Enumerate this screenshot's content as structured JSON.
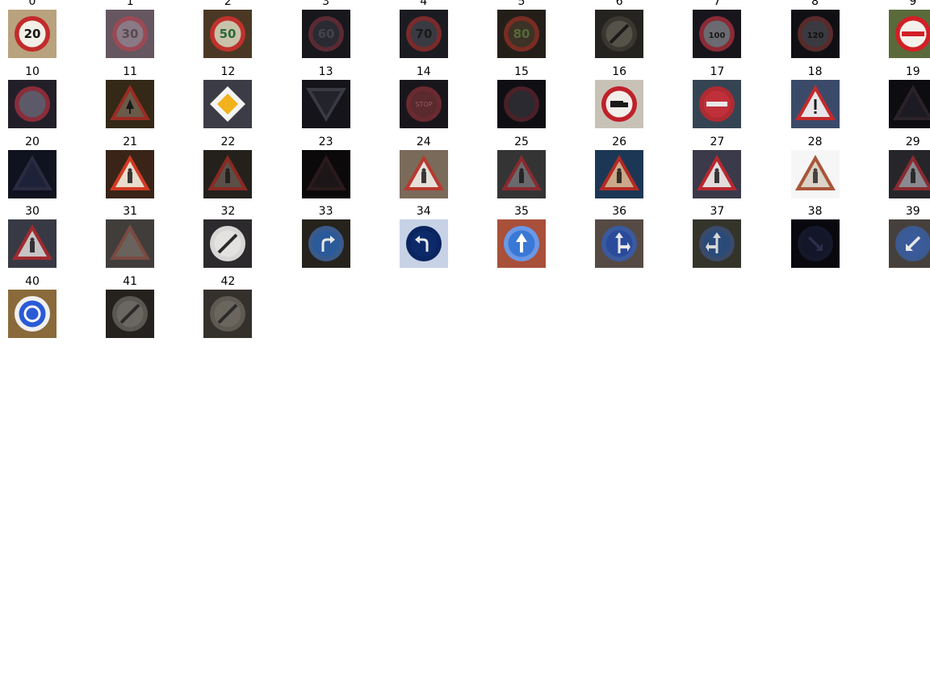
{
  "figure": {
    "columns": 10,
    "background_color": "#ffffff"
  },
  "thumbnails": [
    {
      "label": "0",
      "shape": "circle",
      "icon": "speed-limit-20-sign",
      "bg": "#b9a27e",
      "plate": "#f2efe6",
      "rim": "#c22b2b",
      "symbol": "20",
      "symbol_color": "#141414",
      "bright": 1.0
    },
    {
      "label": "1",
      "shape": "circle",
      "icon": "speed-limit-30-sign",
      "bg": "#6c5b65",
      "plate": "#8a7a86",
      "rim": "#9a4a55",
      "symbol": "30",
      "symbol_color": "#5a4a50",
      "bright": 0.9
    },
    {
      "label": "2",
      "shape": "circle",
      "icon": "speed-limit-50-sign",
      "bg": "#4e3c27",
      "plate": "#c9c2aa",
      "rim": "#c0312c",
      "symbol": "50",
      "symbol_color": "#2a6a3a",
      "bright": 0.9
    },
    {
      "label": "3",
      "shape": "circle",
      "icon": "speed-limit-60-sign",
      "bg": "#1d1d24",
      "plate": "#2a2a33",
      "rim": "#5a2a33",
      "symbol": "60",
      "symbol_color": "#444450",
      "bright": 0.6
    },
    {
      "label": "4",
      "shape": "circle",
      "icon": "speed-limit-70-sign",
      "bg": "#1f2026",
      "plate": "#3a3a42",
      "rim": "#7a2a2a",
      "symbol": "70",
      "symbol_color": "#1a1a1a",
      "bright": 0.75
    },
    {
      "label": "5",
      "shape": "circle",
      "icon": "speed-limit-80-sign",
      "bg": "#2e2620",
      "plate": "#3c3226",
      "rim": "#7a2c22",
      "symbol": "80",
      "symbol_color": "#556b3a",
      "bright": 0.6
    },
    {
      "label": "6",
      "shape": "circle",
      "icon": "end-speed-limit-80-sign",
      "bg": "#2c2a25",
      "plate": "#55524a",
      "rim": "#3a3630",
      "symbol": "/",
      "symbol_color": "#1a1a1a",
      "bright": 0.7
    },
    {
      "label": "7",
      "shape": "circle",
      "icon": "speed-limit-100-sign",
      "bg": "#1c1820",
      "plate": "#6a6a70",
      "rim": "#8a2a35",
      "symbol": "100",
      "symbol_color": "#1a1a1a",
      "bright": 0.75
    },
    {
      "label": "8",
      "shape": "circle",
      "icon": "speed-limit-120-sign",
      "bg": "#15151a",
      "plate": "#3a3a40",
      "rim": "#5a2a2a",
      "symbol": "120",
      "symbol_color": "#111111",
      "bright": 0.6
    },
    {
      "label": "9",
      "shape": "circle",
      "icon": "no-overtaking-sign",
      "bg": "#5a6a3a",
      "plate": "#f4f1ec",
      "rim": "#d21f26",
      "symbol": "==",
      "symbol_color": "#d21f26",
      "bright": 1.0
    },
    {
      "label": "10",
      "shape": "circle",
      "icon": "no-overtaking-trucks-sign",
      "bg": "#2a2530",
      "plate": "#5c5a68",
      "rim": "#8a2c3a",
      "symbol": "",
      "symbol_color": "#2a2a2a",
      "bright": 0.7
    },
    {
      "label": "11",
      "shape": "triangle",
      "icon": "right-of-way-sign",
      "bg": "#3c2e1a",
      "plate": "#6a5a48",
      "rim": "#9a2c22",
      "symbol": "^",
      "symbol_color": "#1a1a1a",
      "bright": 0.75
    },
    {
      "label": "12",
      "shape": "diamond",
      "icon": "priority-road-sign",
      "bg": "#3c3c46",
      "plate": "#f2f2f0",
      "rim": "#f4f4f4",
      "symbol": "",
      "symbol_color": "#f2b21c",
      "bright": 1.0
    },
    {
      "label": "13",
      "shape": "inverted",
      "icon": "yield-sign",
      "bg": "#1a1b22",
      "plate": "#23242b",
      "rim": "#3a3a42",
      "symbol": "",
      "symbol_color": "#1a1a1a",
      "bright": 0.55
    },
    {
      "label": "14",
      "shape": "circle",
      "icon": "stop-sign",
      "bg": "#1e1a20",
      "plate": "#5a2a2e",
      "rim": "#6a2a30",
      "symbol": "STOP",
      "symbol_color": "#9a5a60",
      "bright": 0.7
    },
    {
      "label": "15",
      "shape": "circle",
      "icon": "no-vehicles-sign",
      "bg": "#14141a",
      "plate": "#2a2a30",
      "rim": "#4a2028",
      "symbol": "",
      "symbol_color": "#1a1a1a",
      "bright": 0.5
    },
    {
      "label": "16",
      "shape": "circle",
      "icon": "no-trucks-sign",
      "bg": "#c8c2b6",
      "plate": "#f2eeea",
      "rim": "#c0202a",
      "symbol": "truck",
      "symbol_color": "#1a1a1a",
      "bright": 1.0
    },
    {
      "label": "17",
      "shape": "circle",
      "icon": "no-entry-sign",
      "bg": "#3a4a5a",
      "plate": "#c0303a",
      "rim": "#b02a32",
      "symbol": "-",
      "symbol_color": "#e8e8e8",
      "bright": 0.85
    },
    {
      "label": "18",
      "shape": "triangle",
      "icon": "general-caution-sign",
      "bg": "#3c4a6a",
      "plate": "#e8e6ea",
      "rim": "#c42a2a",
      "symbol": "!",
      "symbol_color": "#1a1a1a",
      "bright": 1.0
    },
    {
      "label": "19",
      "shape": "triangle",
      "icon": "dangerous-curve-left-sign",
      "bg": "#141218",
      "plate": "#1c1a22",
      "rim": "#2a2228",
      "symbol": "",
      "symbol_color": "#1a1a1a",
      "bright": 0.4
    },
    {
      "label": "20",
      "shape": "triangle",
      "icon": "dangerous-curve-right-sign",
      "bg": "#15182a",
      "plate": "#1e2238",
      "rim": "#2a2a40",
      "symbol": "",
      "symbol_color": "#3a3a5a",
      "bright": 0.5
    },
    {
      "label": "21",
      "shape": "triangle",
      "icon": "double-curve-sign",
      "bg": "#3a2418",
      "plate": "#e8dccc",
      "rim": "#d23a22",
      "symbol": "s",
      "symbol_color": "#1a1a1a",
      "bright": 1.0
    },
    {
      "label": "22",
      "shape": "triangle",
      "icon": "bumpy-road-sign",
      "bg": "#2a2620",
      "plate": "#5a5048",
      "rim": "#8a2a22",
      "symbol": "~",
      "symbol_color": "#1a1a1a",
      "bright": 0.75
    },
    {
      "label": "23",
      "shape": "triangle",
      "icon": "slippery-road-sign",
      "bg": "#120e10",
      "plate": "#1c1618",
      "rim": "#2a1a1c",
      "symbol": "",
      "symbol_color": "#1a1a1a",
      "bright": 0.4
    },
    {
      "label": "24",
      "shape": "triangle",
      "icon": "road-narrows-sign",
      "bg": "#7a6a5a",
      "plate": "#e6e0da",
      "rim": "#b83a2e",
      "symbol": "|",
      "symbol_color": "#1a1a1a",
      "bright": 1.0
    },
    {
      "label": "25",
      "shape": "triangle",
      "icon": "road-work-sign",
      "bg": "#3a3a3c",
      "plate": "#6a6a6e",
      "rim": "#8a2a2e",
      "symbol": "w",
      "symbol_color": "#1a1a1a",
      "bright": 0.8
    },
    {
      "label": "26",
      "shape": "triangle",
      "icon": "traffic-signals-sign",
      "bg": "#1e3a5a",
      "plate": "#caa88a",
      "rim": "#b42a22",
      "symbol": "i",
      "symbol_color": "#1a1a1a",
      "bright": 0.9
    },
    {
      "label": "27",
      "shape": "triangle",
      "icon": "pedestrians-sign",
      "bg": "#3a3a4a",
      "plate": "#e2dcdc",
      "rim": "#b8282e",
      "symbol": "p",
      "symbol_color": "#1a1a1a",
      "bright": 1.0
    },
    {
      "label": "28",
      "shape": "triangle",
      "icon": "children-crossing-sign",
      "bg": "#f6f6f6",
      "plate": "#dcd4c8",
      "rim": "#a8563a",
      "symbol": "c",
      "symbol_color": "#2a2a2a",
      "bright": 1.0
    },
    {
      "label": "29",
      "shape": "triangle",
      "icon": "bicycles-crossing-sign",
      "bg": "#2a2a2e",
      "plate": "#8a8a90",
      "rim": "#8a2a30",
      "symbol": "b",
      "symbol_color": "#1a1a1a",
      "bright": 0.85
    },
    {
      "label": "30",
      "shape": "triangle",
      "icon": "beware-of-ice-sign",
      "bg": "#3a3e48",
      "plate": "#c8c4c6",
      "rim": "#a02a2e",
      "symbol": "*",
      "symbol_color": "#1a1a1a",
      "bright": 0.9
    },
    {
      "label": "31",
      "shape": "triangle",
      "icon": "wild-animals-crossing-sign",
      "bg": "#4a4644",
      "plate": "#6a625c",
      "rim": "#7a4a40",
      "symbol": "",
      "symbol_color": "#3a3430",
      "bright": 0.75
    },
    {
      "label": "32",
      "shape": "circle",
      "icon": "end-all-limits-sign",
      "bg": "#2c2a2c",
      "plate": "#e4e2e0",
      "rim": "#d8d6d4",
      "symbol": "/",
      "symbol_color": "#2a2a2a",
      "bright": 1.0
    },
    {
      "label": "33",
      "shape": "circle",
      "icon": "turn-right-ahead-sign",
      "bg": "#2a2620",
      "plate": "#2a5a9a",
      "rim": "#3a5a8a",
      "symbol": "r",
      "symbol_color": "#e8e8e8",
      "bright": 0.85
    },
    {
      "label": "34",
      "shape": "circle",
      "icon": "turn-left-ahead-sign",
      "bg": "#c8d2e6",
      "plate": "#0c2a6a",
      "rim": "#0a2460",
      "symbol": "l",
      "symbol_color": "#e8e8e8",
      "bright": 1.0
    },
    {
      "label": "35",
      "shape": "circle",
      "icon": "ahead-only-sign",
      "bg": "#a8503a",
      "plate": "#3a78d6",
      "rim": "#6a98e6",
      "symbol": "up",
      "symbol_color": "#ffffff",
      "bright": 1.0
    },
    {
      "label": "36",
      "shape": "circle",
      "icon": "go-straight-or-right-sign",
      "bg": "#5a5048",
      "plate": "#2a4a9a",
      "rim": "#3a5aa0",
      "symbol": "sr",
      "symbol_color": "#e8e8e8",
      "bright": 0.9
    },
    {
      "label": "37",
      "shape": "circle",
      "icon": "go-straight-or-left-sign",
      "bg": "#3a3a30",
      "plate": "#2a4a7a",
      "rim": "#3a4a6a",
      "symbol": "sl",
      "symbol_color": "#d8d8d8",
      "bright": 0.8
    },
    {
      "label": "38",
      "shape": "circle",
      "icon": "keep-right-sign",
      "bg": "#0c0c14",
      "plate": "#121628",
      "rim": "#14182a",
      "symbol": "kr",
      "symbol_color": "#2a2e4a",
      "bright": 0.45
    },
    {
      "label": "39",
      "shape": "circle",
      "icon": "keep-left-sign",
      "bg": "#4a4440",
      "plate": "#3a5a9a",
      "rim": "#3a5a90",
      "symbol": "kl",
      "symbol_color": "#e8e8e8",
      "bright": 0.9
    },
    {
      "label": "40",
      "shape": "circle",
      "icon": "roundabout-mandatory-sign",
      "bg": "#8a6a3a",
      "plate": "#2a5ad6",
      "rim": "#f0f0f0",
      "symbol": "o",
      "symbol_color": "#ffffff",
      "bright": 1.0
    },
    {
      "label": "41",
      "shape": "circle",
      "icon": "end-of-no-passing-sign",
      "bg": "#2a2622",
      "plate": "#6a6660",
      "rim": "#5a5650",
      "symbol": "/",
      "symbol_color": "#2a2a2a",
      "bright": 0.8
    },
    {
      "label": "42",
      "shape": "circle",
      "icon": "end-no-passing-trucks-sign",
      "bg": "#3a3630",
      "plate": "#6a665e",
      "rim": "#5e5a52",
      "symbol": "/",
      "symbol_color": "#2a2a2a",
      "bright": 0.8
    }
  ]
}
